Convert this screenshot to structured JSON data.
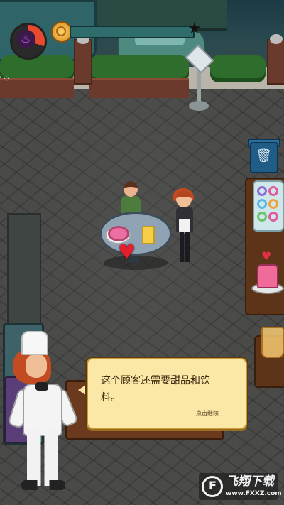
{
  "hud": {
    "flame_icon": "flame-icon",
    "coin_icon": "coin-icon",
    "star_icon": "star-icon",
    "xp_progress": 0.0,
    "colors": {
      "gauge": "#e84a2f",
      "xp_bar": "#2f6c6c",
      "flame": "#c45cff"
    }
  },
  "dialog": {
    "message": "这个顾客还需要甜品和饮料。",
    "hint": "点击继续",
    "bg_color": "#fbe8a6"
  },
  "order": {
    "icon": "heart-icon",
    "color": "#e21e2f"
  },
  "trash": {
    "icon": "trash-icon"
  },
  "watermark": {
    "title": "飞翔下载",
    "url": "www.FXXZ.com"
  }
}
